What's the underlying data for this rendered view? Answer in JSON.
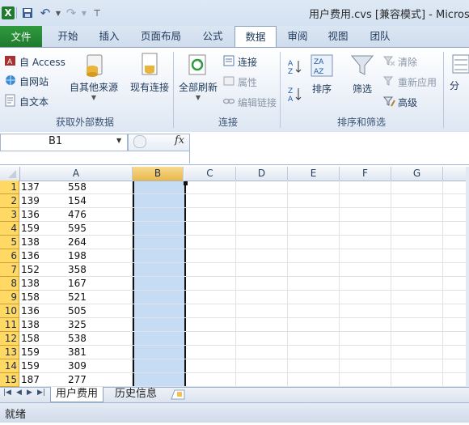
{
  "title": "用户费用.cvs  [兼容模式] - Microso",
  "tabs": [
    {
      "label": "文件"
    },
    {
      "label": "开始"
    },
    {
      "label": "插入"
    },
    {
      "label": "页面布局"
    },
    {
      "label": "公式"
    },
    {
      "label": "数据"
    },
    {
      "label": "审阅"
    },
    {
      "label": "视图"
    },
    {
      "label": "团队"
    }
  ],
  "active_tab": "数据",
  "ribbon": {
    "get_external": {
      "access": "自 Access",
      "web": "自网站",
      "text": "自文本",
      "other_sources": "自其他来源",
      "existing": "现有连接",
      "group": "获取外部数据"
    },
    "connections": {
      "refresh_all": "全部刷新",
      "connections": "连接",
      "properties": "属性",
      "edit_links": "编辑链接",
      "group": "连接"
    },
    "sort_filter": {
      "sort": "排序",
      "filter": "筛选",
      "clear": "清除",
      "reapply": "重新应用",
      "advanced": "高级",
      "group": "排序和筛选"
    },
    "more": "分"
  },
  "formula_bar": {
    "name_box": "B1",
    "fx": "fx",
    "formula": ""
  },
  "columns": [
    "A",
    "B",
    "C",
    "D",
    "E",
    "F",
    "G"
  ],
  "selected_column": "B",
  "rows": [
    {
      "n": "1",
      "a1": "137",
      "a2": "558"
    },
    {
      "n": "2",
      "a1": "139",
      "a2": "154"
    },
    {
      "n": "3",
      "a1": "136",
      "a2": "476"
    },
    {
      "n": "4",
      "a1": "159",
      "a2": "595"
    },
    {
      "n": "5",
      "a1": "138",
      "a2": "264"
    },
    {
      "n": "6",
      "a1": "136",
      "a2": "198"
    },
    {
      "n": "7",
      "a1": "152",
      "a2": "358"
    },
    {
      "n": "8",
      "a1": "138",
      "a2": "167"
    },
    {
      "n": "9",
      "a1": "158",
      "a2": "521"
    },
    {
      "n": "10",
      "a1": "136",
      "a2": "505"
    },
    {
      "n": "11",
      "a1": "138",
      "a2": "325"
    },
    {
      "n": "12",
      "a1": "158",
      "a2": "538"
    },
    {
      "n": "13",
      "a1": "159",
      "a2": "381"
    },
    {
      "n": "14",
      "a1": "159",
      "a2": "309"
    },
    {
      "n": "15",
      "a1": "187",
      "a2": "277"
    }
  ],
  "sheets": [
    "用户费用",
    "历史信息"
  ],
  "active_sheet": "用户费用",
  "status": "就绪",
  "colors": {
    "file_tab": "#1f7a2e",
    "row_header": "#ffd964",
    "selection": "#c6dcf4"
  }
}
